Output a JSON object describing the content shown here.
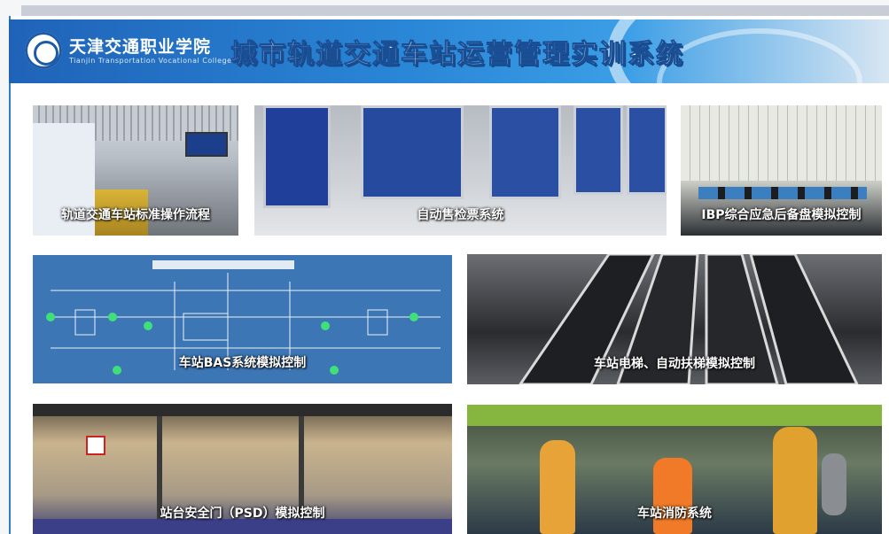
{
  "header": {
    "school_name": "天津交通职业学院",
    "school_name_en": "Tianjin Transportation Vocational College",
    "system_title": "城市轨道交通车站运营管理实训系统"
  },
  "tiles": [
    {
      "label": "轨道交通车站标准操作流程"
    },
    {
      "label": "自动售检票系统"
    },
    {
      "label": "IBP综合应急后备盘模拟控制"
    },
    {
      "label": "车站BAS系统模拟控制"
    },
    {
      "label": "车站电梯、自动扶梯模拟控制"
    },
    {
      "label": "站台安全门（PSD）模拟控制"
    },
    {
      "label": "车站消防系统"
    }
  ],
  "colors": {
    "banner_start": "#1f63b8",
    "banner_end": "#d8e6f2",
    "frame_border": "#2d7ec4"
  }
}
